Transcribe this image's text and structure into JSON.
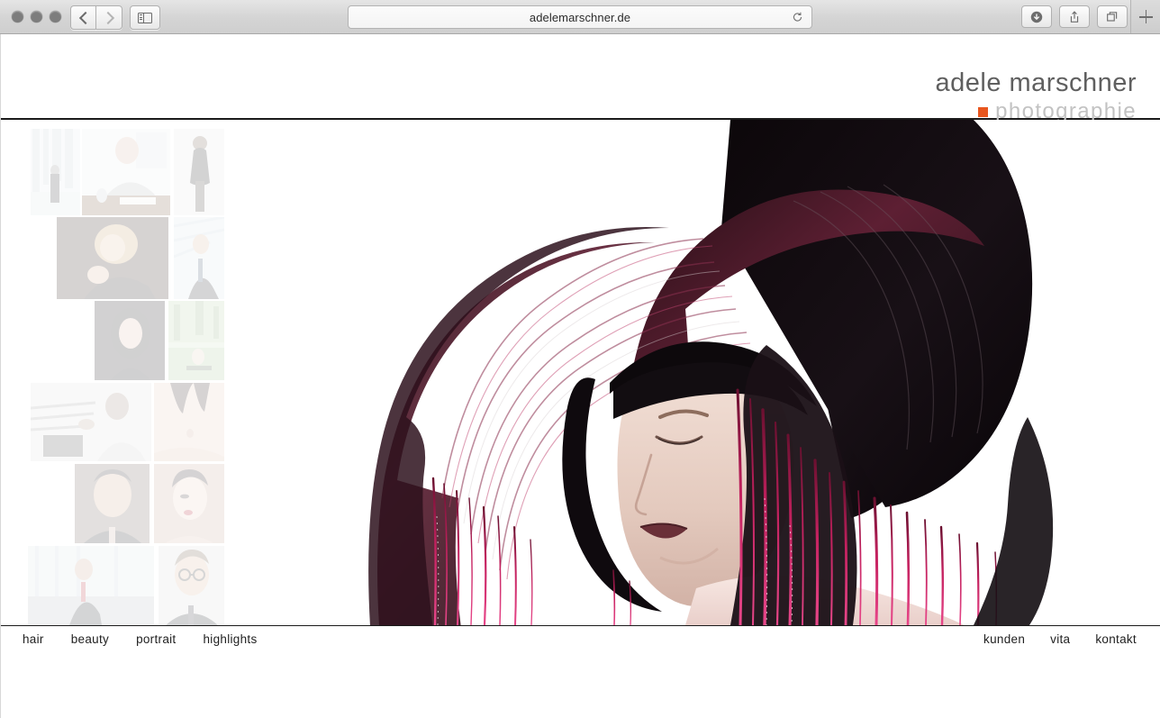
{
  "browser": {
    "title": "adelemarschner.de",
    "url": "adelemarschner.de",
    "traffic_lights": [
      "close",
      "minimize",
      "zoom"
    ],
    "back_label": "Back",
    "forward_label": "Forward",
    "sidebar_label": "Show Sidebar",
    "reload_label": "Reload",
    "downloads_label": "Downloads",
    "share_label": "Share",
    "tabs_label": "Show All Tabs",
    "newtab_label": "New Tab"
  },
  "site": {
    "logo": {
      "name": "adele marschner",
      "tagline": "photographie",
      "accent_color": "#e8561e",
      "name_color": "#5f5f5f",
      "tagline_color": "#c2c2c2"
    },
    "nav_left": [
      {
        "label": "hair"
      },
      {
        "label": "beauty"
      },
      {
        "label": "portrait"
      },
      {
        "label": "highlights"
      }
    ],
    "nav_right": [
      {
        "label": "kunden"
      },
      {
        "label": "vita"
      },
      {
        "label": "kontakt"
      }
    ],
    "thumbnails": [
      {
        "name": "businessman-in-lobby",
        "row": 1
      },
      {
        "name": "man-at-conference-table",
        "row": 1
      },
      {
        "name": "woman-in-black-dress",
        "row": 1
      },
      {
        "name": "blonde-woman-portrait",
        "row": 2
      },
      {
        "name": "businessman-outdoor-portrait",
        "row": 2
      },
      {
        "name": "dark-haired-woman-beauty",
        "row": 3
      },
      {
        "name": "park-scene-figure",
        "row": 3
      },
      {
        "name": "man-at-machinery-bw",
        "row": 4
      },
      {
        "name": "hand-on-torso-beauty",
        "row": 4
      },
      {
        "name": "older-man-portrait",
        "row": 5
      },
      {
        "name": "short-hair-woman-red-lips",
        "row": 5
      },
      {
        "name": "businessman-in-office",
        "row": 6
      },
      {
        "name": "man-with-glasses-portrait",
        "row": 6
      }
    ],
    "hero": {
      "alt": "fashion hair portrait: woman with dark bob and magenta dripping strands",
      "hair_dark": "#140d10",
      "hair_burgundy": "#5a1f33",
      "strand_pink": "#d6246c",
      "skin": "#efd8cf",
      "background": "#ffffff"
    }
  }
}
